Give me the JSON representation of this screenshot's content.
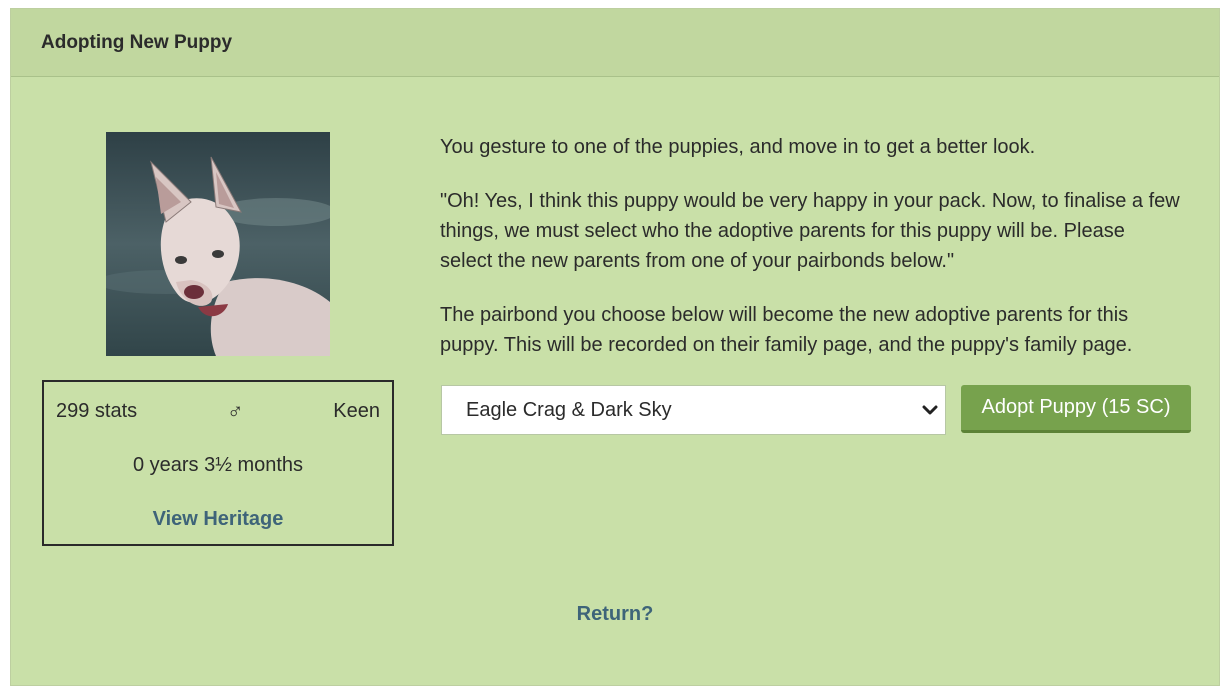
{
  "panel": {
    "title": "Adopting New Puppy"
  },
  "puppy": {
    "stats": "299 stats",
    "gender_symbol": "♂",
    "trait": "Keen",
    "age": "0 years 3½ months",
    "heritage_link": "View Heritage"
  },
  "dialog": {
    "paragraphs": [
      "You gesture to one of the puppies, and move in to get a better look.",
      "\"Oh! Yes, I think this puppy would be very happy in your pack. Now, to finalise a few things, we must select who the adoptive parents for this puppy will be. Please select the new parents from one of your pairbonds below.\"",
      "The pairbond you choose below will become the new adoptive parents for this puppy. This will be recorded on their family page, and the puppy's family page."
    ]
  },
  "form": {
    "pairbond_selected": "Eagle Crag & Dark Sky",
    "adopt_button": "Adopt Puppy (15 SC)"
  },
  "footer": {
    "return_link": "Return?"
  }
}
